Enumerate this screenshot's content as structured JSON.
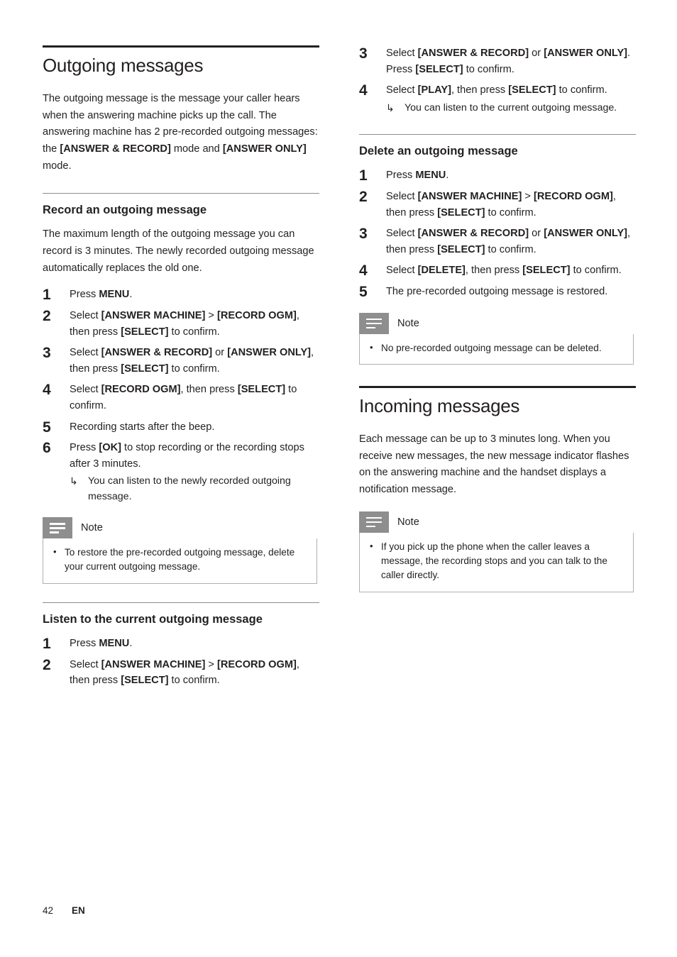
{
  "left_column": {
    "title": "Outgoing messages",
    "intro": [
      {
        "t": "The outgoing message is the message your caller hears when the answering machine picks up the call. The answering machine has 2 pre-recorded outgoing messages: the ",
        "b": false
      },
      {
        "t": "[ANSWER & RECORD]",
        "b": true
      },
      {
        "t": " mode and ",
        "b": false
      },
      {
        "t": "[ANSWER ONLY]",
        "b": true
      },
      {
        "t": " mode.",
        "b": false
      }
    ],
    "section1": {
      "heading": "Record an outgoing message",
      "paragraph": "The maximum length of the outgoing message you can record is 3 minutes. The newly recorded outgoing message automatically replaces the old one.",
      "steps": [
        {
          "num": "1",
          "parts": [
            {
              "t": "Press ",
              "b": false
            },
            {
              "t": "MENU",
              "b": true
            },
            {
              "t": ".",
              "b": false
            }
          ]
        },
        {
          "num": "2",
          "parts": [
            {
              "t": "Select ",
              "b": false
            },
            {
              "t": "[ANSWER MACHINE]",
              "b": true
            },
            {
              "t": " > ",
              "b": false
            },
            {
              "t": "[RECORD OGM]",
              "b": true
            },
            {
              "t": ", then press ",
              "b": false
            },
            {
              "t": "[SELECT]",
              "b": true
            },
            {
              "t": " to confirm.",
              "b": false
            }
          ]
        },
        {
          "num": "3",
          "parts": [
            {
              "t": "Select ",
              "b": false
            },
            {
              "t": "[ANSWER & RECORD]",
              "b": true
            },
            {
              "t": " or ",
              "b": false
            },
            {
              "t": "[ANSWER ONLY]",
              "b": true
            },
            {
              "t": ", then press ",
              "b": false
            },
            {
              "t": "[SELECT]",
              "b": true
            },
            {
              "t": " to confirm.",
              "b": false
            }
          ]
        },
        {
          "num": "4",
          "parts": [
            {
              "t": "Select ",
              "b": false
            },
            {
              "t": "[RECORD OGM]",
              "b": true
            },
            {
              "t": ", then press ",
              "b": false
            },
            {
              "t": "[SELECT]",
              "b": true
            },
            {
              "t": " to confirm.",
              "b": false
            }
          ]
        },
        {
          "num": "5",
          "parts": [
            {
              "t": "Recording starts after the beep.",
              "b": false
            }
          ]
        },
        {
          "num": "6",
          "parts": [
            {
              "t": "Press ",
              "b": false
            },
            {
              "t": "[OK]",
              "b": true
            },
            {
              "t": " to stop recording or the recording stops after 3 minutes.",
              "b": false
            }
          ],
          "subnote": "You can listen to the newly recorded outgoing message."
        }
      ],
      "note": {
        "label": "Note",
        "items": [
          "To restore the pre-recorded outgoing message, delete your current outgoing message."
        ]
      }
    },
    "section2": {
      "heading": "Listen to the current outgoing message",
      "steps": [
        {
          "num": "1",
          "parts": [
            {
              "t": "Press ",
              "b": false
            },
            {
              "t": "MENU",
              "b": true
            },
            {
              "t": ".",
              "b": false
            }
          ]
        },
        {
          "num": "2",
          "parts": [
            {
              "t": "Select ",
              "b": false
            },
            {
              "t": "[ANSWER MACHINE]",
              "b": true
            },
            {
              "t": " > ",
              "b": false
            },
            {
              "t": "[RECORD OGM]",
              "b": true
            },
            {
              "t": ", then press ",
              "b": false
            },
            {
              "t": "[SELECT]",
              "b": true
            },
            {
              "t": " to confirm.",
              "b": false
            }
          ]
        }
      ]
    }
  },
  "right_column": {
    "continued_steps": [
      {
        "num": "3",
        "parts": [
          {
            "t": "Select ",
            "b": false
          },
          {
            "t": "[ANSWER & RECORD]",
            "b": true
          },
          {
            "t": " or ",
            "b": false
          },
          {
            "t": "[ANSWER ONLY]",
            "b": true
          },
          {
            "t": ". Press ",
            "b": false
          },
          {
            "t": "[SELECT]",
            "b": true
          },
          {
            "t": " to confirm.",
            "b": false
          }
        ]
      },
      {
        "num": "4",
        "parts": [
          {
            "t": "Select ",
            "b": false
          },
          {
            "t": "[PLAY]",
            "b": true
          },
          {
            "t": ", then press ",
            "b": false
          },
          {
            "t": "[SELECT]",
            "b": true
          },
          {
            "t": " to confirm.",
            "b": false
          }
        ],
        "subnote": "You can listen to the current outgoing message."
      }
    ],
    "section1": {
      "heading": "Delete an outgoing message",
      "steps": [
        {
          "num": "1",
          "parts": [
            {
              "t": "Press ",
              "b": false
            },
            {
              "t": "MENU",
              "b": true
            },
            {
              "t": ".",
              "b": false
            }
          ]
        },
        {
          "num": "2",
          "parts": [
            {
              "t": "Select ",
              "b": false
            },
            {
              "t": "[ANSWER MACHINE]",
              "b": true
            },
            {
              "t": " > ",
              "b": false
            },
            {
              "t": "[RECORD OGM]",
              "b": true
            },
            {
              "t": ", then press ",
              "b": false
            },
            {
              "t": "[SELECT]",
              "b": true
            },
            {
              "t": " to confirm.",
              "b": false
            }
          ]
        },
        {
          "num": "3",
          "parts": [
            {
              "t": "Select ",
              "b": false
            },
            {
              "t": "[ANSWER & RECORD]",
              "b": true
            },
            {
              "t": " or ",
              "b": false
            },
            {
              "t": "[ANSWER ONLY]",
              "b": true
            },
            {
              "t": ", then press ",
              "b": false
            },
            {
              "t": "[SELECT]",
              "b": true
            },
            {
              "t": " to confirm.",
              "b": false
            }
          ]
        },
        {
          "num": "4",
          "parts": [
            {
              "t": "Select ",
              "b": false
            },
            {
              "t": "[DELETE]",
              "b": true
            },
            {
              "t": ", then press ",
              "b": false
            },
            {
              "t": "[SELECT]",
              "b": true
            },
            {
              "t": " to confirm.",
              "b": false
            }
          ]
        },
        {
          "num": "5",
          "parts": [
            {
              "t": "The pre-recorded outgoing message is restored.",
              "b": false
            }
          ]
        }
      ],
      "note": {
        "label": "Note",
        "items": [
          "No pre-recorded outgoing message can be deleted."
        ]
      }
    },
    "section2": {
      "title": "Incoming messages",
      "paragraph": "Each message can be up to 3 minutes long. When you receive new messages, the new message indicator flashes on the answering machine and the handset displays a notification message.",
      "note": {
        "label": "Note",
        "items": [
          "If you pick up the phone when the caller leaves a message, the recording stops and you can talk to the caller directly."
        ]
      }
    }
  },
  "footer": {
    "page_number": "42",
    "language": "EN"
  }
}
